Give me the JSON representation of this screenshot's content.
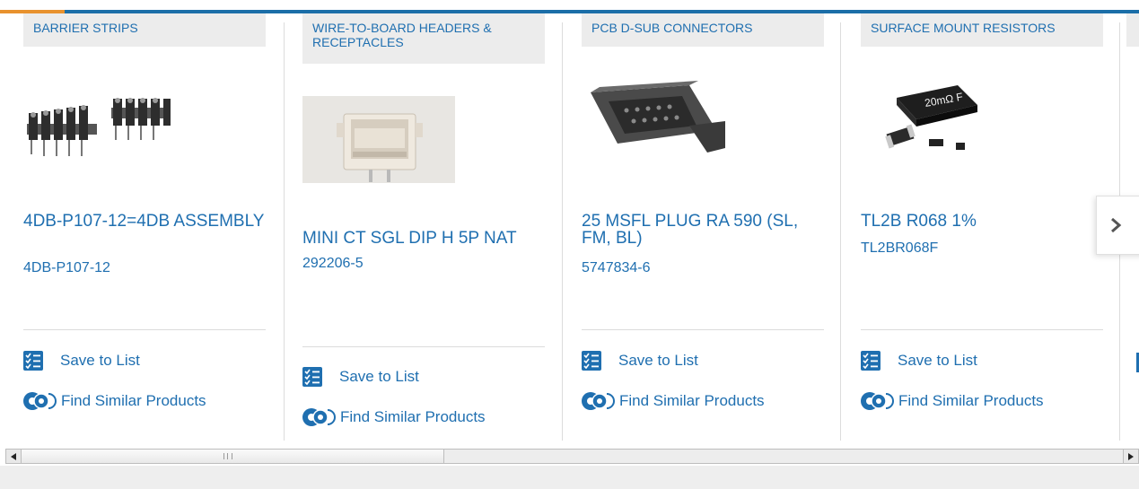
{
  "colors": {
    "brand_blue": "#1b6ea8",
    "link_blue": "#1f6fb0",
    "accent_orange": "#e8922e",
    "tab_gray": "#ececec"
  },
  "products": [
    {
      "category": "BARRIER STRIPS",
      "title": "4DB-P107-12=4DB ASSEMBLY",
      "part_number": "4DB-P107-12",
      "image_icon": "barrier-strip-image"
    },
    {
      "category": "WIRE-TO-BOARD HEADERS & RECEPTACLES",
      "title": "MINI CT SGL DIP H 5P NAT",
      "part_number": "292206-5",
      "image_icon": "header-connector-image"
    },
    {
      "category": "PCB D-SUB CONNECTORS",
      "title": "25 MSFL PLUG RA 590 (SL, FM, BL)",
      "part_number": "5747834-6",
      "image_icon": "dsub-connector-image"
    },
    {
      "category": "SURFACE MOUNT RESISTORS",
      "title": "TL2B R068 1%",
      "part_number": "TL2BR068F",
      "image_icon": "smd-resistor-image",
      "resistor_marking": "20mΩ F"
    }
  ],
  "actions": {
    "save_label": "Save to List",
    "similar_label": "Find Similar Products"
  },
  "icons": {
    "save": "checklist-icon",
    "similar": "gears-icon",
    "next": "chevron-right-icon"
  }
}
